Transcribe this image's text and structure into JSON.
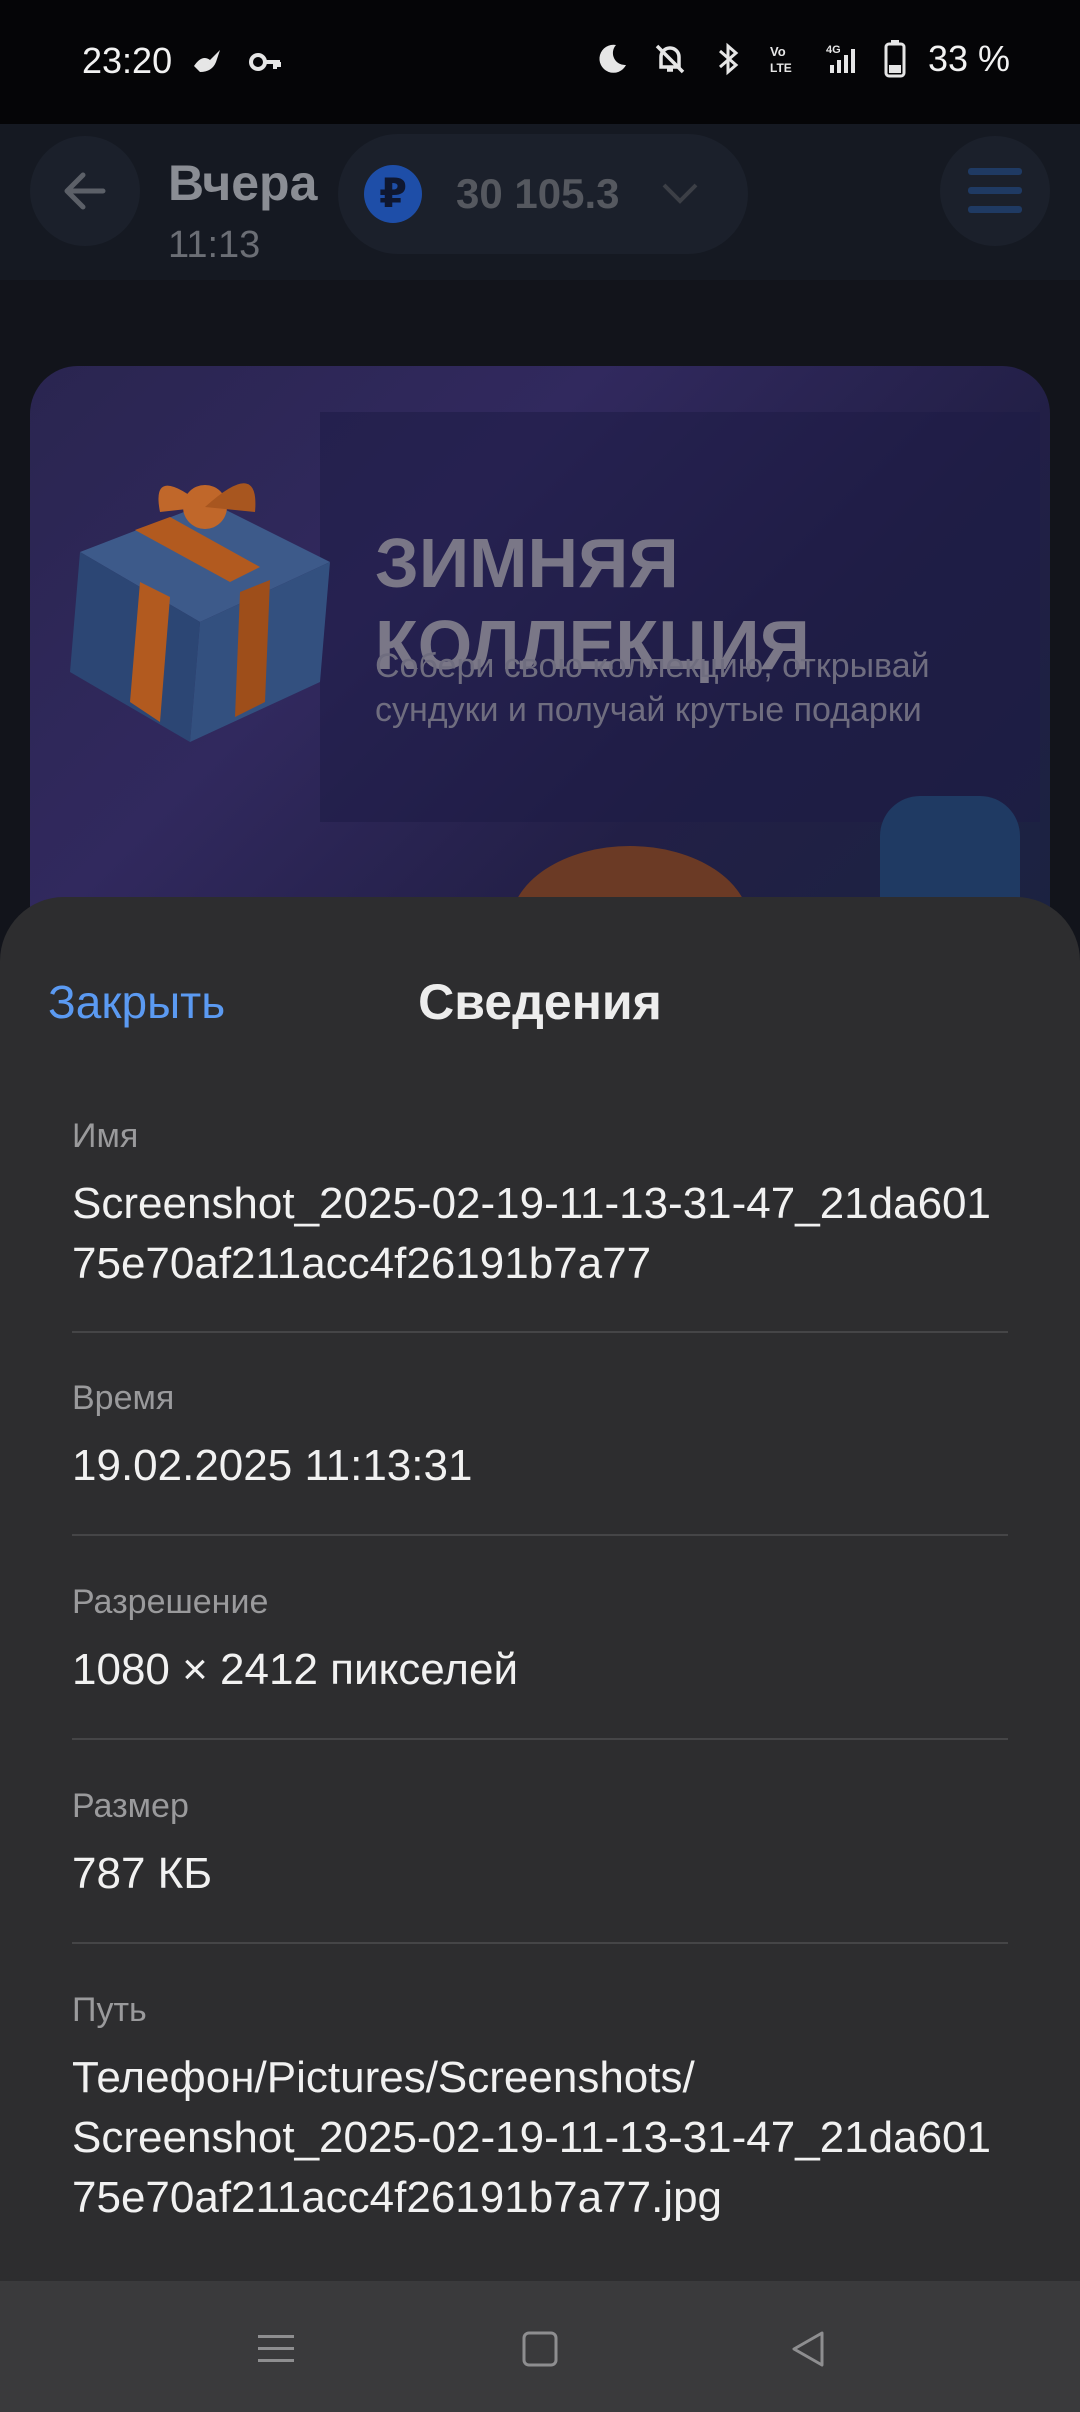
{
  "status_bar": {
    "time": "23:20",
    "battery": "33 %",
    "icons": [
      "bird-icon",
      "key-icon",
      "moon-icon",
      "bell-off-icon",
      "bluetooth-icon",
      "volte-icon",
      "4g-signal-icon",
      "battery-icon"
    ]
  },
  "app": {
    "title": "Вчера",
    "subtitle": "11:13",
    "balance": "30 105.3",
    "currency_symbol": "₽"
  },
  "banner": {
    "title_line1": "ЗИМНЯЯ",
    "title_line2": "КОЛЛЕКЦИЯ",
    "description": "Собери свою коллекцию, открывай сундуки и получай крутые подарки"
  },
  "sheet": {
    "close_label": "Закрыть",
    "title": "Сведения",
    "fields": [
      {
        "label": "Имя",
        "value": "Screenshot_2025-02-19-11-13-31-47_21da60175e70af211acc4f26191b7a77"
      },
      {
        "label": "Время",
        "value": "19.02.2025 11:13:31"
      },
      {
        "label": "Разрешение",
        "value": "1080 × 2412 пикселей"
      },
      {
        "label": "Размер",
        "value": "787 КБ"
      },
      {
        "label": "Путь",
        "value": "Телефон/Pictures/Screenshots/\nScreenshot_2025-02-19-11-13-31-47_21da60175e70af211acc4f26191b7a77.jpg"
      }
    ]
  },
  "colors": {
    "accent": "#5b9af2",
    "sheet_bg": "#2d2d2f",
    "nav_bg": "#3a3a3c"
  }
}
